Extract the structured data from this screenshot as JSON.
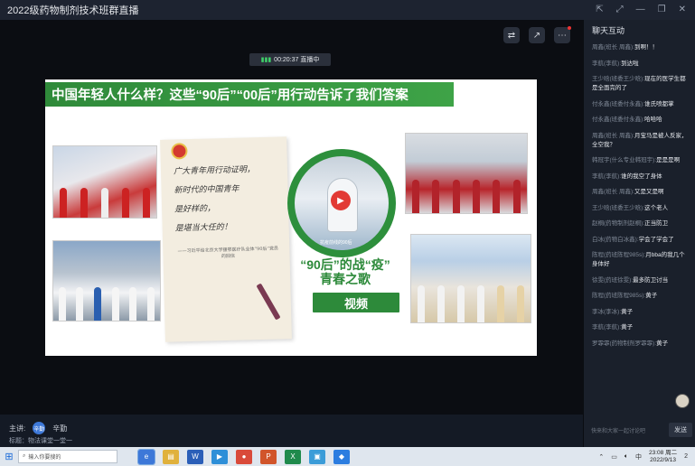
{
  "window": {
    "title": "2022级药物制剂技术班群直播",
    "controls": [
      "⇱",
      "⤢",
      "—",
      "❐",
      "✕"
    ]
  },
  "video": {
    "top_icons": [
      "layout-switch-icon",
      "share-icon",
      "more-icon"
    ],
    "timer": "00:20:37 直播中"
  },
  "slide": {
    "headline": "中国年轻人什么样？这些“90后”“00后”用行动告诉了我们答案",
    "letter_lines": [
      "广大青年用行动证明，",
      "新时代的中国青年",
      "是好样的，",
      "是堪当大任的！"
    ],
    "letter_signature": "——习近平给北京大学援鄂医疗队全体“90后”党员的回信",
    "circle_caption": "抗疫前线的90后",
    "song_title_line1": "“90后”的战“疫”",
    "song_title_line2": "青春之歌",
    "video_button": "视频"
  },
  "bottom": {
    "host_label": "主讲:",
    "host_avatar": "辛勤",
    "host_name": "辛勤",
    "topic": "标题：物法课堂一堂一"
  },
  "chat": {
    "header": "聊天互动",
    "messages": [
      {
        "who": "周鑫(班长 周鑫):",
        "text": "到啊！！"
      },
      {
        "who": "李航(李航):",
        "text": "到达啦"
      },
      {
        "who": "王少晗(班委王少晗):",
        "text": "现在的医学生都是全面完的了"
      },
      {
        "who": "付永鑫(班委付永鑫):",
        "text": "谁氏喷都掌"
      },
      {
        "who": "付永鑫(班委付永鑫):",
        "text": "哈哈哈"
      },
      {
        "who": "周鑫(班长 周鑫):",
        "text": "月宝马是被人反家，全空我？"
      },
      {
        "who": "韩冠宇(什么专业韩冠宇):",
        "text": "是是是啊"
      },
      {
        "who": "李航(李航):",
        "text": "谁的我空了身体"
      },
      {
        "who": "周鑫(班长 周鑫):",
        "text": "又是又是啊"
      },
      {
        "who": "王少晗(班委王少晗):",
        "text": "这个老人"
      },
      {
        "who": "赵桐(药物制剂赵桐):",
        "text": "正当防卫"
      },
      {
        "who": "白冰(药物白冰鑫):",
        "text": "学会了学会了"
      },
      {
        "who": "陈程(药班陈程985s):",
        "text": "月bba的我几个身体好"
      },
      {
        "who": "徐雯(药班徐雯):",
        "text": "最多防卫讨当"
      },
      {
        "who": "陈程(药班陈程985s):",
        "text": "黄子"
      },
      {
        "who": "李冰(李冰):",
        "text": "黄子"
      },
      {
        "who": "李航(李航):",
        "text": "黄子"
      },
      {
        "who": "罗霏霏(药物制剂罗霏霏):",
        "text": "黄子"
      }
    ],
    "input_placeholder": "快来和大家一起讨论吧",
    "send_label": "发送"
  },
  "taskbar": {
    "search_placeholder": "输入你要搜的",
    "apps": [
      {
        "name": "browser-app",
        "color": "#3d78d8",
        "glyph": "e"
      },
      {
        "name": "explorer-app",
        "color": "#e0b13c",
        "glyph": "▤"
      },
      {
        "name": "word-app",
        "color": "#2b5fb8",
        "glyph": "W"
      },
      {
        "name": "media-app",
        "color": "#2e8fd8",
        "glyph": "▶"
      },
      {
        "name": "chrome-app",
        "color": "#d94a3a",
        "glyph": "●"
      },
      {
        "name": "powerpoint-app",
        "color": "#d1552b",
        "glyph": "P"
      },
      {
        "name": "excel-app",
        "color": "#1f8a4c",
        "glyph": "X"
      },
      {
        "name": "photos-app",
        "color": "#3b9cd8",
        "glyph": "▣"
      },
      {
        "name": "live-app",
        "color": "#2c7de0",
        "glyph": "◆"
      }
    ],
    "tray_lang": "中",
    "time": "23:08 周二",
    "date": "2022/9/13",
    "notify": "2"
  }
}
